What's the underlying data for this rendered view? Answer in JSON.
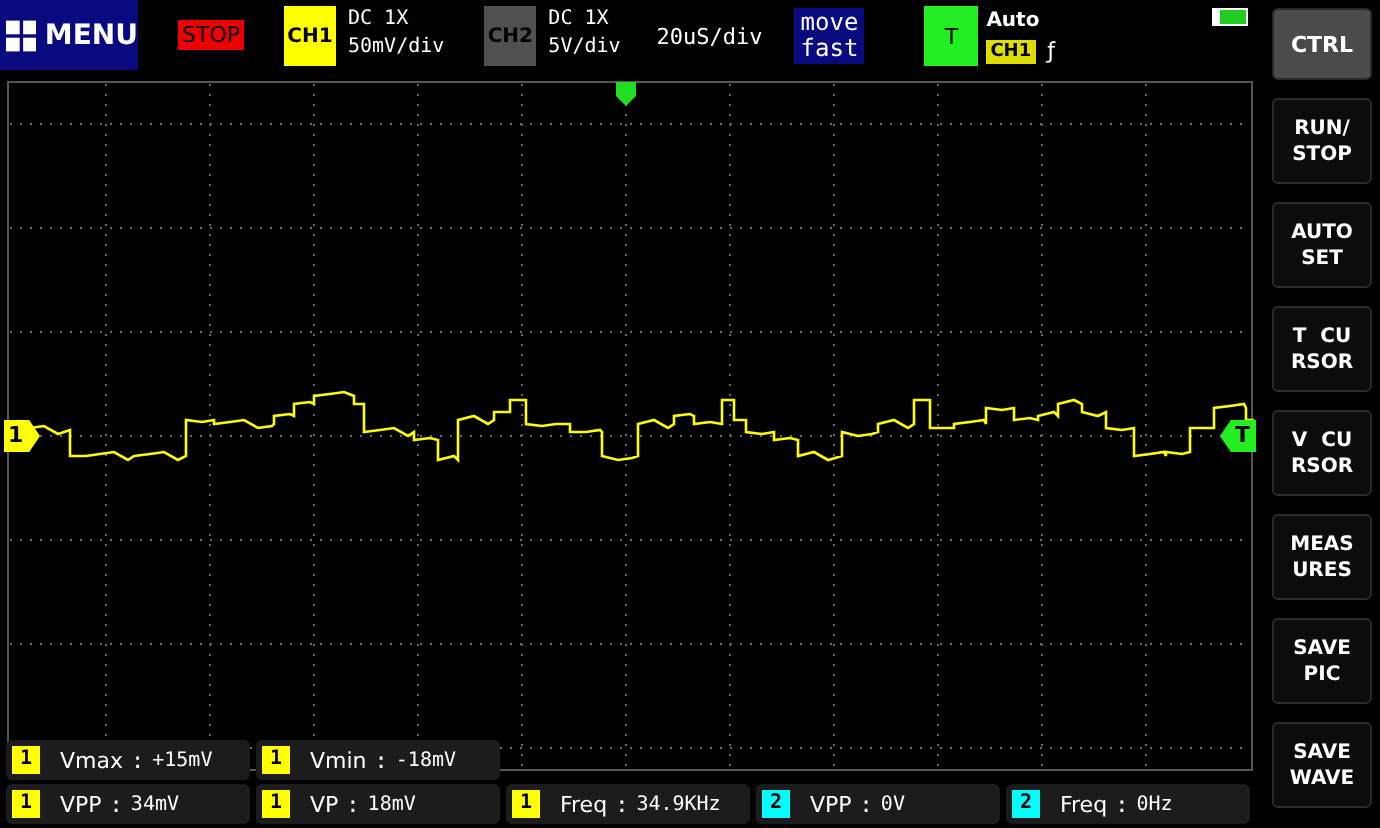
{
  "top_bar": {
    "menu": {
      "label": "MENU"
    },
    "run_state": {
      "label": "STOP"
    },
    "channels": [
      {
        "label": "CH1",
        "color": "#ffff00",
        "coupling": "DC",
        "probe": "1X",
        "scale": "50mV/div"
      },
      {
        "label": "CH2",
        "color": "#505050",
        "coupling": "DC",
        "probe": "1X",
        "scale": "5V/div"
      }
    ],
    "timebase": "20uS/div",
    "move_mode": {
      "lines": [
        "move",
        "fast"
      ]
    },
    "trigger": {
      "label": "T",
      "mode": "Auto",
      "source": "CH1",
      "edge": "ƒ"
    }
  },
  "plot": {
    "ch1_marker": "1",
    "trigger_marker": "T"
  },
  "measurements": [
    [
      {
        "channel": "1",
        "color": "#ffff00",
        "name": "Vmax",
        "separator": ":",
        "value": "+15mV"
      },
      {
        "channel": "1",
        "color": "#ffff00",
        "name": "Vmin",
        "separator": ":",
        "value": "-18mV"
      }
    ],
    [
      {
        "channel": "1",
        "color": "#ffff00",
        "name": "VPP",
        "separator": ":",
        "value": "34mV"
      },
      {
        "channel": "1",
        "color": "#ffff00",
        "name": "VP",
        "separator": ":",
        "value": "18mV"
      },
      {
        "channel": "1",
        "color": "#ffff00",
        "name": "Freq",
        "separator": ":",
        "value": "34.9KHz"
      },
      {
        "channel": "2",
        "color": "#00ffff",
        "name": "VPP",
        "separator": ":",
        "value": "0V"
      },
      {
        "channel": "2",
        "color": "#00ffff",
        "name": "Freq",
        "separator": ":",
        "value": "0Hz"
      }
    ]
  ],
  "sidebar": [
    {
      "lines": [
        "CTRL"
      ],
      "selected": true
    },
    {
      "lines": [
        "RUN/",
        "STOP"
      ],
      "selected": false
    },
    {
      "lines": [
        "AUTO",
        "SET"
      ],
      "selected": false
    },
    {
      "lines": [
        "T  CU",
        "RSOR"
      ],
      "selected": false
    },
    {
      "lines": [
        "V  CU",
        "RSOR"
      ],
      "selected": false
    },
    {
      "lines": [
        "MEAS",
        "URES"
      ],
      "selected": false
    },
    {
      "lines": [
        "SAVE",
        "PIC"
      ],
      "selected": false
    },
    {
      "lines": [
        "SAVE",
        "WAVE"
      ],
      "selected": false
    }
  ]
}
